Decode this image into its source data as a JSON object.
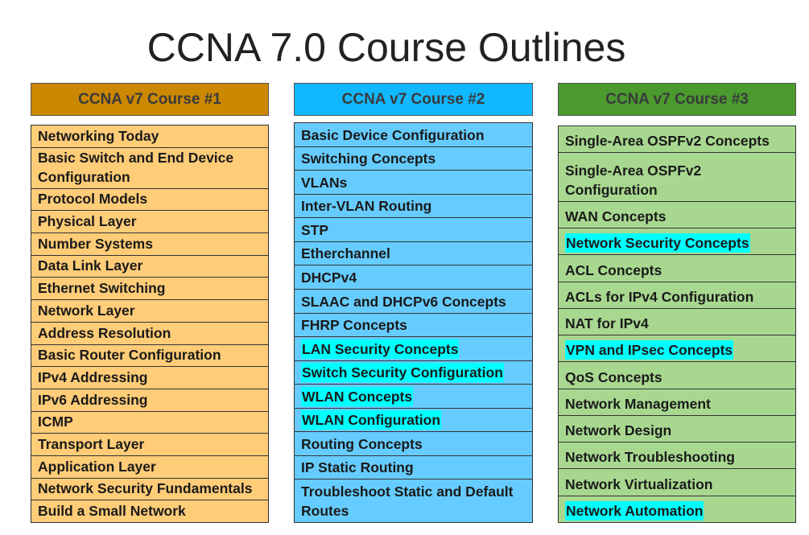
{
  "title": "CCNA 7.0 Course Outlines",
  "courses": [
    {
      "header": "CCNA v7 Course #1",
      "header_color": "#cc8800",
      "list_color": "#ffcc77",
      "items": [
        {
          "label": "Networking Today"
        },
        {
          "label": "Basic Switch and End Device Configuration",
          "double": true
        },
        {
          "label": "Protocol Models"
        },
        {
          "label": "Physical Layer"
        },
        {
          "label": "Number Systems"
        },
        {
          "label": "Data Link Layer"
        },
        {
          "label": "Ethernet Switching"
        },
        {
          "label": "Network Layer"
        },
        {
          "label": "Address Resolution"
        },
        {
          "label": "Basic Router Configuration"
        },
        {
          "label": "IPv4 Addressing"
        },
        {
          "label": "IPv6 Addressing"
        },
        {
          "label": "ICMP"
        },
        {
          "label": "Transport Layer"
        },
        {
          "label": "Application Layer"
        },
        {
          "label": "Network Security Fundamentals"
        },
        {
          "label": "Build a Small Network"
        }
      ]
    },
    {
      "header": "CCNA v7 Course #2",
      "header_color": "#11b8ff",
      "list_color": "#66ccff",
      "items": [
        {
          "label": "Basic Device Configuration"
        },
        {
          "label": "Switching Concepts"
        },
        {
          "label": "VLANs"
        },
        {
          "label": "Inter-VLAN Routing"
        },
        {
          "label": "STP"
        },
        {
          "label": "Etherchannel"
        },
        {
          "label": "DHCPv4"
        },
        {
          "label": "SLAAC and DHCPv6 Concepts"
        },
        {
          "label": "FHRP Concepts"
        },
        {
          "label": "LAN Security Concepts",
          "highlight": true
        },
        {
          "label": "Switch Security Configuration",
          "highlight": true
        },
        {
          "label": "WLAN Concepts",
          "highlight": true
        },
        {
          "label": "WLAN Configuration",
          "highlight": true
        },
        {
          "label": "Routing Concepts"
        },
        {
          "label": "IP Static Routing"
        },
        {
          "label": "Troubleshoot Static and Default Routes",
          "double": true
        }
      ]
    },
    {
      "header": "CCNA v7 Course #3",
      "header_color": "#4a9a2e",
      "list_color": "#a8d890",
      "items": [
        {
          "label": "Single-Area OSPFv2 Concepts"
        },
        {
          "label": "Single-Area OSPFv2 Configuration",
          "double": true
        },
        {
          "label": "WAN Concepts"
        },
        {
          "label": "Network Security Concepts",
          "highlight": true
        },
        {
          "label": "ACL Concepts"
        },
        {
          "label": "ACLs for IPv4 Configuration"
        },
        {
          "label": "NAT for IPv4"
        },
        {
          "label": "VPN and IPsec Concepts",
          "highlight": true
        },
        {
          "label": "QoS Concepts"
        },
        {
          "label": "Network Management"
        },
        {
          "label": "Network Design"
        },
        {
          "label": "Network Troubleshooting"
        },
        {
          "label": "Network Virtualization"
        },
        {
          "label": "Network Automation",
          "highlight": true
        }
      ]
    }
  ]
}
